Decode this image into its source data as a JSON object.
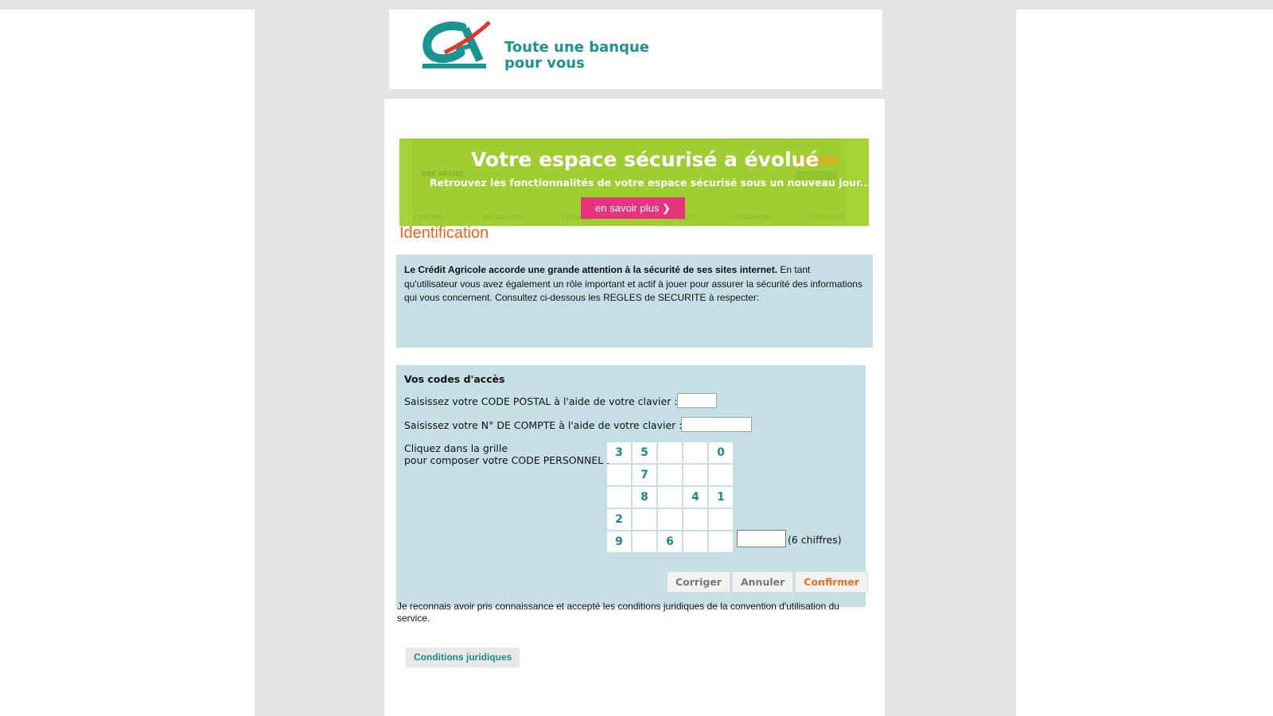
{
  "header": {
    "slogan_line1": "Toute une banque",
    "slogan_line2": "pour vous"
  },
  "banner": {
    "small_logo_text": "DES SAVOIE",
    "meta": "Votre dernière connexion : 28 avril 2016 à 10:15",
    "title": "Votre espace sécurisé a évolué",
    "subtitle": "Retrouvez les fonctionnalités de votre espace sécurisé sous un nouveau jour...",
    "cta": "en savoir plus  ❯",
    "nav": [
      "COMPTES",
      "MESSAGERIE",
      "CONSEILS",
      "",
      "CRÉDITS",
      "ÉPARGNER",
      "S'ASSURER"
    ],
    "background_color": "#a4d335",
    "cta_color": "#e5347b"
  },
  "page_title": "Identification",
  "notice": {
    "bold": "Le Crédit Agricole accorde une grande attention à la sécurité de ses sites internet.",
    "text": " En tant qu'utilisateur vous avez également un rôle important et actif à jouer pour assurer la sécurité des informations qui vous concernent. Consultez ci-dessous les REGLES de SECURITE à respecter:"
  },
  "codes": {
    "heading": "Vos codes d'accès",
    "postal_label": "Saisissez votre CODE POSTAL à l'aide de votre clavier :",
    "account_label": "Saisissez votre N° DE COMPTE à l'aide de votre clavier :",
    "grid_label_line1": "Cliquez dans la grille",
    "grid_label_line2": "pour composer votre CODE PERSONNEL :",
    "grid": [
      [
        "3",
        "5",
        "",
        "",
        "0"
      ],
      [
        "",
        "7",
        "",
        "",
        ""
      ],
      [
        "",
        "8",
        "",
        "4",
        "1"
      ],
      [
        "2",
        "",
        "",
        "",
        ""
      ],
      [
        "9",
        "",
        "6",
        "",
        ""
      ]
    ],
    "digits_hint": "(6 chiffres)",
    "buttons": {
      "correct": "Corriger",
      "cancel": "Annuler",
      "confirm": "Confirmer"
    }
  },
  "legal_text": "Je reconnais avoir pris connaissance et accepté les conditions juridiques de la convention d'utilisation du service.",
  "legal_button": "Conditions juridiques",
  "colors": {
    "brand_teal": "#1a948f",
    "accent_orange": "#f06419",
    "panel": "#c5e0e4"
  }
}
